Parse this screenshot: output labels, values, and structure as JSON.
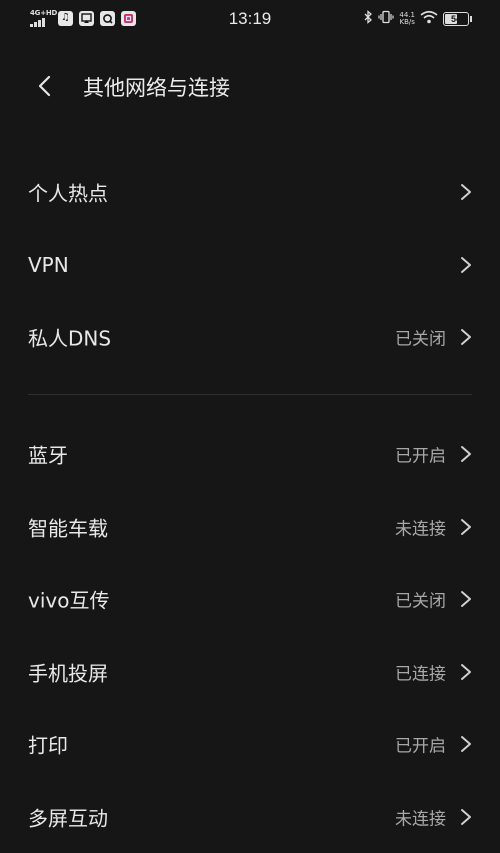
{
  "status_bar": {
    "network": "4G+HD",
    "time": "13:19",
    "speed_value": "44.1",
    "speed_unit": "KB/s",
    "battery": "54",
    "battery_fraction": 0.54
  },
  "header": {
    "title": "其他网络与连接"
  },
  "group1": [
    {
      "label": "个人热点",
      "value": ""
    },
    {
      "label": "VPN",
      "value": ""
    },
    {
      "label": "私人DNS",
      "value": "已关闭"
    }
  ],
  "group2": [
    {
      "label": "蓝牙",
      "value": "已开启"
    },
    {
      "label": "智能车载",
      "value": "未连接"
    },
    {
      "label": "vivo互传",
      "value": "已关闭"
    },
    {
      "label": "手机投屏",
      "value": "已连接"
    },
    {
      "label": "打印",
      "value": "已开启"
    },
    {
      "label": "多屏互动",
      "value": "未连接"
    }
  ],
  "icons": {
    "back": "chevron-left-icon",
    "row_arrow": "chevron-right-icon"
  },
  "colors": {
    "background": "#161616",
    "text": "#e8e8e8",
    "secondary_text": "#a8a8a8",
    "divider": "#2e2e2e"
  }
}
